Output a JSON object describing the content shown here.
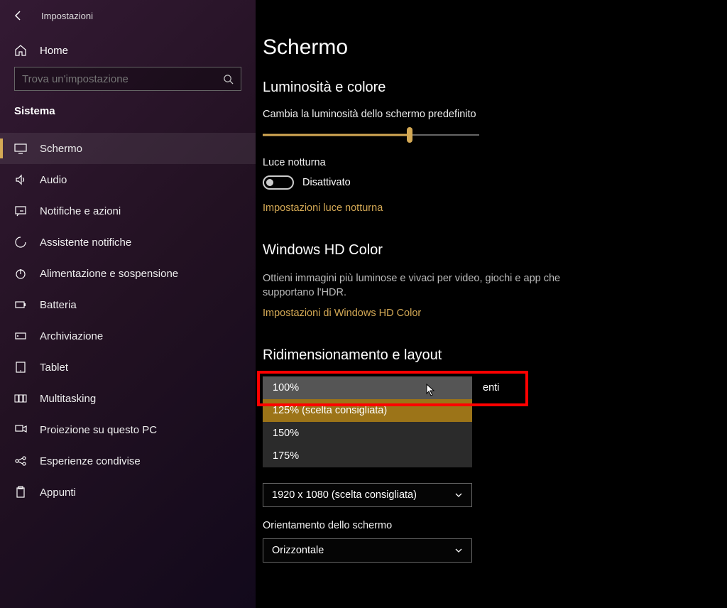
{
  "window": {
    "title": "Impostazioni"
  },
  "sidebar": {
    "home": "Home",
    "search_placeholder": "Trova un'impostazione",
    "category": "Sistema",
    "items": [
      {
        "label": "Schermo"
      },
      {
        "label": "Audio"
      },
      {
        "label": "Notifiche e azioni"
      },
      {
        "label": "Assistente notifiche"
      },
      {
        "label": "Alimentazione e sospensione"
      },
      {
        "label": "Batteria"
      },
      {
        "label": "Archiviazione"
      },
      {
        "label": "Tablet"
      },
      {
        "label": "Multitasking"
      },
      {
        "label": "Proiezione su questo PC"
      },
      {
        "label": "Esperienze condivise"
      },
      {
        "label": "Appunti"
      }
    ]
  },
  "main": {
    "title": "Schermo",
    "brightness": {
      "section": "Luminosità e colore",
      "label": "Cambia la luminosità dello schermo predefinito",
      "value_pct": 68,
      "night_label": "Luce notturna",
      "toggle_state": "Disattivato",
      "night_link": "Impostazioni luce notturna"
    },
    "hd": {
      "section": "Windows HD Color",
      "desc": "Ottieni immagini più luminose e vivaci per video, giochi e app che supportano l'HDR.",
      "link": "Impostazioni di Windows HD Color"
    },
    "scaling": {
      "section": "Ridimensionamento e layout",
      "partial_text": "enti",
      "options": [
        {
          "label": "100%",
          "hover": true
        },
        {
          "label": "125% (scelta consigliata)",
          "selected": true
        },
        {
          "label": "150%"
        },
        {
          "label": "175%"
        }
      ],
      "resolution": "1920 x 1080 (scelta consigliata)",
      "orient_label": "Orientamento dello schermo",
      "orient_value": "Orizzontale"
    }
  }
}
